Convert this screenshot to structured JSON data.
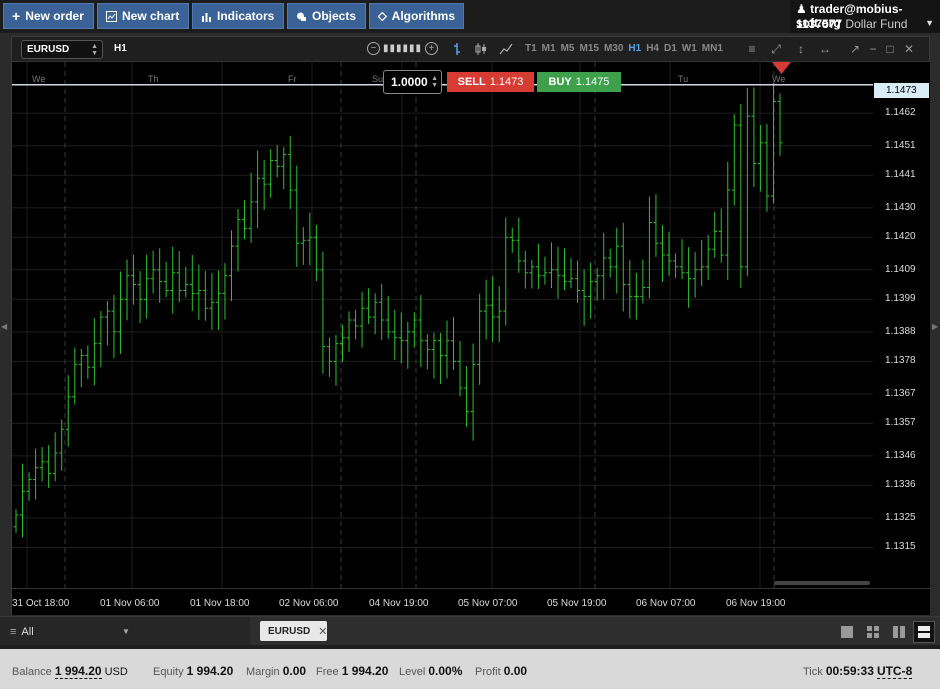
{
  "toolbar": {
    "new_order": "New order",
    "new_chart": "New chart",
    "indicators": "Indicators",
    "objects": "Objects",
    "algorithms": "Algorithms"
  },
  "account": {
    "user": "trader@mobius-soft.org",
    "id": "1137577",
    "fund": "Dollar Fund"
  },
  "chart_window": {
    "symbol": "EURUSD",
    "timeframe": "H1",
    "timeframes": [
      "T1",
      "M1",
      "M5",
      "M15",
      "M30",
      "H1",
      "H4",
      "D1",
      "W1",
      "MN1"
    ],
    "active_timeframe": "H1",
    "quantity": "1.0000",
    "sell_label": "SELL",
    "sell_price": "1.1473",
    "buy_label": "BUY",
    "buy_price": "1.1475",
    "current_price": "1.1473"
  },
  "chart_data": {
    "type": "ohlc",
    "symbol": "EURUSD",
    "timeframe": "H1",
    "bar_color": "#2fbf2f",
    "y_ticks": [
      "1.1462",
      "1.1451",
      "1.1441",
      "1.1430",
      "1.1420",
      "1.1409",
      "1.1399",
      "1.1388",
      "1.1378",
      "1.1367",
      "1.1357",
      "1.1346",
      "1.1336",
      "1.1325",
      "1.1315"
    ],
    "x_ticks": [
      "31 Oct 18:00",
      "01 Nov 06:00",
      "01 Nov 18:00",
      "02 Nov 06:00",
      "04 Nov 19:00",
      "05 Nov 07:00",
      "05 Nov 19:00",
      "06 Nov 07:00",
      "06 Nov 19:00"
    ],
    "day_labels": [
      "We",
      "Th",
      "Fr",
      "Su",
      "Tu",
      "We"
    ],
    "ylim": [
      1.1305,
      1.1478
    ],
    "close_series": [
      1.1326,
      1.1334,
      1.1338,
      1.1342,
      1.1344,
      1.134,
      1.1347,
      1.1355,
      1.1366,
      1.1377,
      1.138,
      1.1376,
      1.1384,
      1.1393,
      1.1395,
      1.1388,
      1.1399,
      1.1407,
      1.1404,
      1.1399,
      1.1406,
      1.1409,
      1.1405,
      1.1402,
      1.1408,
      1.1402,
      1.1404,
      1.1401,
      1.1402,
      1.1396,
      1.1398,
      1.1401,
      1.1407,
      1.1417,
      1.1426,
      1.1423,
      1.1432,
      1.144,
      1.1438,
      1.1446,
      1.1444,
      1.1448,
      1.1436,
      1.1418,
      1.1419,
      1.142,
      1.1409,
      1.1383,
      1.1378,
      1.1384,
      1.1386,
      1.1392,
      1.139,
      1.1396,
      1.1393,
      1.1398,
      1.1392,
      1.1388,
      1.1386,
      1.1385,
      1.1388,
      1.1392,
      1.1385,
      1.1382,
      1.1385,
      1.138,
      1.1385,
      1.1378,
      1.1369,
      1.1361,
      1.1377,
      1.1395,
      1.1397,
      1.1393,
      1.1395,
      1.142,
      1.1419,
      1.1412,
      1.1408,
      1.141,
      1.1407,
      1.1408,
      1.1409,
      1.1407,
      1.1405,
      1.1406,
      1.1402,
      1.14,
      1.1405,
      1.1407,
      1.1413,
      1.141,
      1.1417,
      1.1404,
      1.14,
      1.14,
      1.1403,
      1.1425,
      1.1418,
      1.1414,
      1.1412,
      1.141,
      1.1408,
      1.1406,
      1.1409,
      1.141,
      1.1416,
      1.1422,
      1.1414,
      1.1436,
      1.1458,
      1.141,
      1.1461,
      1.1445,
      1.1452,
      1.1434,
      1.1466,
      1.1452
    ]
  },
  "tabs": {
    "filter": "All",
    "chart_tab": "EURUSD"
  },
  "status": {
    "balance_label": "Balance",
    "balance_value": "1 994.20",
    "balance_currency": "USD",
    "equity_label": "Equity",
    "equity_value": "1 994.20",
    "margin_label": "Margin",
    "margin_value": "0.00",
    "free_label": "Free",
    "free_value": "1 994.20",
    "level_label": "Level",
    "level_value": "0.00%",
    "profit_label": "Profit",
    "profit_value": "0.00",
    "tick_label": "Tick",
    "tick_value": "00:59:33",
    "timezone": "UTC-8"
  }
}
